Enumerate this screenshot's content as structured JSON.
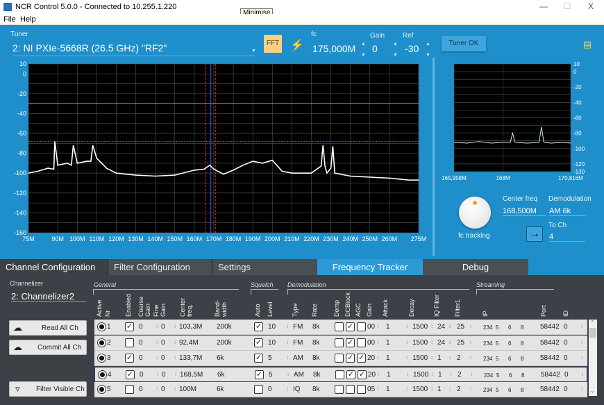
{
  "window": {
    "title": "NCR Control 5.0.0 - Connected to 10.255.1.220",
    "minimize_tooltip": "Minimise",
    "min_icon": "minimize-icon",
    "max_icon": "maximize-icon",
    "close_icon": "close-icon",
    "close": "X"
  },
  "menu": [
    "File",
    "Help"
  ],
  "tuner": {
    "label": "Tuner",
    "value": "2: NI PXIe-5668R (26.5 GHz) \"RF2\"",
    "fft": "FFT",
    "fc_label": "fc",
    "fc": "175,000M",
    "gain_label": "Gain",
    "gain": "0",
    "ref_label": "Ref",
    "ref": "-30",
    "status": "Tuner OK"
  },
  "chart_data": [
    {
      "type": "line",
      "xlim": [
        75,
        275
      ],
      "ylim": [
        -160,
        10
      ],
      "x_unit": "M",
      "xticks": [
        "75M",
        "90M",
        "100M",
        "110M",
        "120M",
        "130M",
        "140M",
        "150M",
        "160M",
        "170M",
        "180M",
        "190M",
        "200M",
        "210M",
        "220M",
        "230M",
        "240M",
        "250M",
        "260M",
        "275M"
      ],
      "xtick_values": [
        75,
        90,
        100,
        110,
        120,
        130,
        140,
        150,
        160,
        170,
        180,
        190,
        200,
        210,
        220,
        230,
        240,
        250,
        260,
        275
      ],
      "yticks": [
        10,
        0,
        -20,
        -40,
        -60,
        -80,
        -100,
        -120,
        -140,
        -160
      ],
      "grid": true,
      "ref_level": -30,
      "squelch_level": -68,
      "markers": [
        165.9,
        168.5,
        170.8
      ],
      "series": [
        {
          "x": [
            75,
            80,
            85,
            88,
            88.5,
            90,
            95,
            97,
            98,
            100,
            105,
            107,
            108,
            110,
            115,
            120,
            125,
            130,
            140,
            150,
            160,
            165,
            168,
            170,
            175,
            180,
            185,
            190,
            195,
            200,
            205,
            210,
            220,
            225,
            226,
            227,
            228,
            230,
            231,
            232,
            240,
            250,
            260,
            270,
            275
          ],
          "y": [
            -100,
            -98,
            -95,
            -96,
            -68,
            -92,
            -90,
            -92,
            -72,
            -90,
            -88,
            -88,
            -72,
            -85,
            -95,
            -100,
            -101,
            -102,
            -103,
            -102,
            -97,
            -96,
            -92,
            -96,
            -101,
            -97,
            -92,
            -88,
            -90,
            -87,
            -98,
            -100,
            -100,
            -93,
            -72,
            -93,
            -100,
            -95,
            -73,
            -100,
            -103,
            -104,
            -105,
            -107,
            -107
          ]
        }
      ]
    },
    {
      "type": "line",
      "xlim": [
        165.958,
        170.816
      ],
      "ylim": [
        -130,
        10
      ],
      "xticks": [
        "165,958M",
        "168M",
        "170,816M"
      ],
      "xtick_values": [
        165.958,
        168,
        170.816
      ],
      "yticks": [
        10,
        0,
        -20,
        -40,
        -60,
        -80,
        -100,
        -120,
        -130
      ],
      "grid": true,
      "series": [
        {
          "x": [
            165.958,
            166.5,
            167,
            167.5,
            168,
            168.3,
            168.4,
            168.5,
            169,
            169.5,
            169.6,
            169.7,
            170,
            170.5,
            170.816
          ],
          "y": [
            -92,
            -93,
            -91,
            -93,
            -92,
            -92,
            -80,
            -92,
            -93,
            -92,
            -72,
            -92,
            -93,
            -92,
            -93
          ]
        }
      ]
    }
  ],
  "tracker": {
    "knob_label": "fc tracking",
    "center_label": "Center freq",
    "center": "168,500M",
    "demod_label": "Demodulation",
    "demod": "AM 6k",
    "toch_label": "To Ch",
    "toch": "4",
    "arrow_icon": "arrow-right-icon"
  },
  "tabs": [
    {
      "label": "Channel Configuration",
      "active": true
    },
    {
      "label": "Filter Configuration"
    },
    {
      "label": "Settings"
    },
    {
      "label": "Frequency Tracker"
    },
    {
      "label": "Debug"
    }
  ],
  "channelizer": {
    "label": "Channelizer",
    "value": "2: Channelizer2"
  },
  "buttons": {
    "read": "Read All Ch",
    "commit": "Commit All Ch",
    "filter": "Filter Visible Ch"
  },
  "groups": {
    "general": "General",
    "squelch": "Squelch",
    "demod": "Demodulation",
    "streaming": "Streaming"
  },
  "columns": [
    "Active",
    "Nr",
    "Enabled",
    "Coarse Gain",
    "Fine Gain",
    "Center freq.",
    "Band-width",
    "Auto",
    "Level",
    "Type",
    "Rate",
    "Demp",
    "DCBlock",
    "AGC",
    "Gain",
    "Attack",
    "Decay",
    "IQ Filter",
    "Filter1",
    "IP",
    "Port",
    "ID"
  ],
  "rows": [
    {
      "nr": "1",
      "enabled": true,
      "coarse": "0",
      "fine": "0",
      "center": "103,3M",
      "bw": "200k",
      "auto": true,
      "level": "10",
      "type": "FM",
      "rate": "8k",
      "demp": false,
      "dcblock": true,
      "agc": false,
      "gain": "00",
      "attack": "1",
      "decay": "1500",
      "iq": "24",
      "filter1": "25",
      "ip": [
        "234",
        "5",
        "6",
        "8"
      ],
      "port": "58442",
      "id": "0"
    },
    {
      "nr": "2",
      "enabled": false,
      "coarse": "0",
      "fine": "0",
      "center": "92,4M",
      "bw": "200k",
      "auto": true,
      "level": "10",
      "type": "FM",
      "rate": "8k",
      "demp": false,
      "dcblock": true,
      "agc": false,
      "gain": "00",
      "attack": "1",
      "decay": "1500",
      "iq": "24",
      "filter1": "25",
      "ip": [
        "234",
        "5",
        "6",
        "8"
      ],
      "port": "58442",
      "id": "0"
    },
    {
      "nr": "3",
      "enabled": true,
      "coarse": "0",
      "fine": "0",
      "center": "133,7M",
      "bw": "6k",
      "auto": true,
      "level": "5",
      "type": "AM",
      "rate": "8k",
      "demp": false,
      "dcblock": true,
      "agc": true,
      "gain": "20",
      "attack": "1",
      "decay": "1500",
      "iq": "1",
      "filter1": "2",
      "ip": [
        "234",
        "5",
        "6",
        "8"
      ],
      "port": "58442",
      "id": "0"
    },
    {
      "nr": "4",
      "enabled": true,
      "coarse": "0",
      "fine": "0",
      "center": "168,5M",
      "bw": "6k",
      "auto": true,
      "level": "5",
      "type": "AM",
      "rate": "8k",
      "demp": false,
      "dcblock": true,
      "agc": true,
      "gain": "20",
      "attack": "1",
      "decay": "1500",
      "iq": "1",
      "filter1": "2",
      "ip": [
        "234",
        "5",
        "6",
        "8"
      ],
      "port": "58442",
      "id": "0",
      "selected": true
    },
    {
      "nr": "5",
      "enabled": false,
      "coarse": "0",
      "fine": "0",
      "center": "100M",
      "bw": "6k",
      "auto": false,
      "level": "0",
      "type": "IQ",
      "rate": "8k",
      "demp": false,
      "dcblock": false,
      "agc": false,
      "gain": "05",
      "attack": "1",
      "decay": "1500",
      "iq": "1",
      "filter1": "2",
      "ip": [
        "234",
        "5",
        "6",
        "8"
      ],
      "port": "58442",
      "id": "0"
    }
  ]
}
